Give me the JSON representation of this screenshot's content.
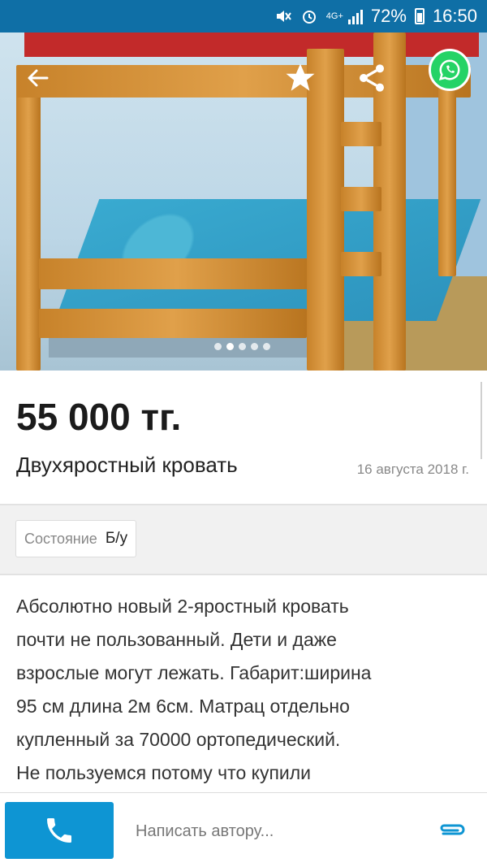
{
  "status_bar": {
    "network": "4G+",
    "battery": "72%",
    "time": "16:50"
  },
  "gallery": {
    "photo_count": 5,
    "active_index": 1
  },
  "listing": {
    "price": "55 000 тг.",
    "title": "Двухяростный кровать",
    "date": "16 августа 2018 г."
  },
  "attributes": {
    "condition_label": "Состояние",
    "condition_value": "Б/у"
  },
  "description": {
    "lines": [
      "Абсолютно новый 2-яростный кровать",
      "почти не пользованный. Дети и даже",
      "взрослые могут лежать. Габарит:ширина",
      "95 см длина 2м 6см. Матрац отдельно",
      "купленный за 70000 ортопедический.",
      "Не пользуемся потому что купили"
    ]
  },
  "bottom_bar": {
    "message_placeholder": "Написать автору..."
  },
  "colors": {
    "status_bar": "#0f6fa6",
    "call_button": "#0e95d3",
    "whatsapp": "#25d366",
    "attach_icon": "#0e95d3"
  }
}
